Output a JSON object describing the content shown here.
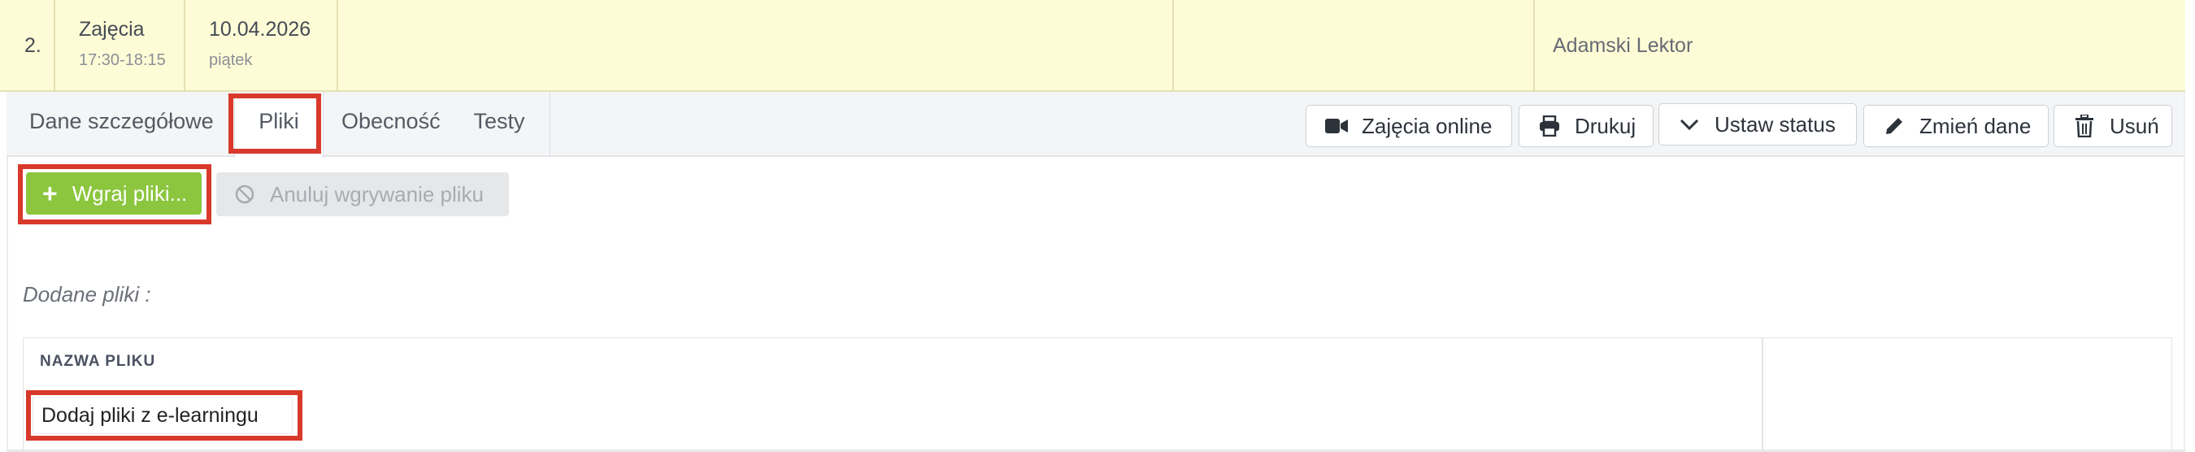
{
  "row": {
    "number": "2.",
    "type": "Zajęcia",
    "time": "17:30-18:15",
    "date": "10.04.2026",
    "weekday": "piątek",
    "lecturer": "Adamski Lektor"
  },
  "tabs": [
    {
      "label": "Dane szczegółowe"
    },
    {
      "label": "Pliki"
    },
    {
      "label": "Obecność"
    },
    {
      "label": "Testy"
    }
  ],
  "actions": {
    "online": "Zajęcia online",
    "print": "Drukuj",
    "status": "Ustaw status",
    "edit": "Zmień dane",
    "delete": "Usuń"
  },
  "upload": {
    "upload_label": "Wgraj pliki...",
    "cancel_label": "Anuluj wgrywanie pliku"
  },
  "files": {
    "section_label": "Dodane pliki :",
    "column_name": "NAZWA PLIKU",
    "elearning_link": "Dodaj pliki z e-learningu"
  },
  "colors": {
    "row_bg": "#fefcd6",
    "upload_green": "#8cc63f",
    "highlight_red": "#d8392b"
  }
}
